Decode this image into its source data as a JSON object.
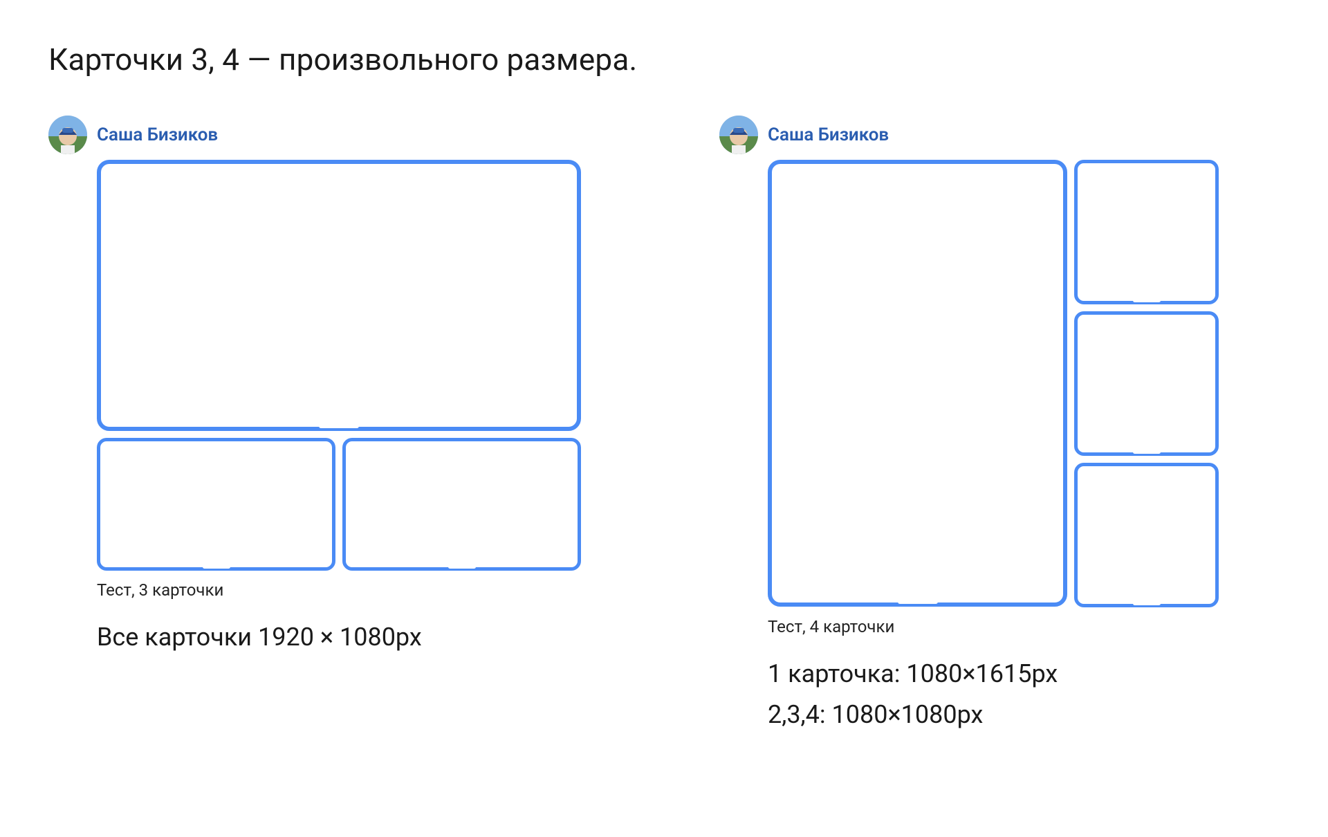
{
  "title": "Карточки 3, 4 — произвольного размера.",
  "blue": "#4a8bf5",
  "author_link_color": "#2a5db0",
  "left": {
    "author": "Саша Бизиков",
    "caption": "Тест, 3 карточки",
    "desc1": "Все карточки 1920 × 1080px"
  },
  "right": {
    "author": "Саша Бизиков",
    "caption": "Тест, 4 карточки",
    "desc1": "1 карточка: 1080×1615px",
    "desc2": "2,3,4: 1080×1080px"
  }
}
